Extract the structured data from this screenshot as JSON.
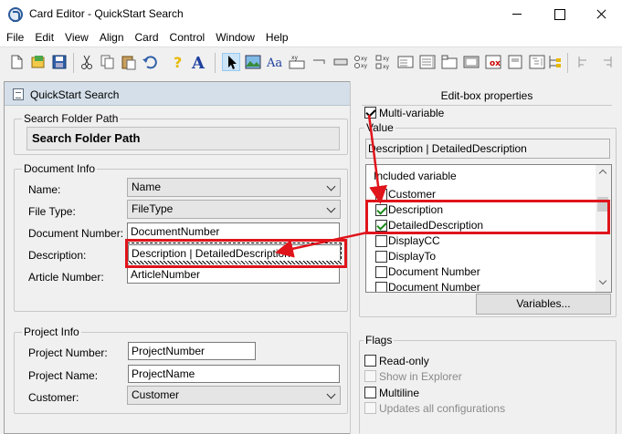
{
  "window": {
    "title": "Card Editor - QuickStart Search"
  },
  "menu": [
    "File",
    "Edit",
    "View",
    "Align",
    "Card",
    "Control",
    "Window",
    "Help"
  ],
  "toolbar": {
    "icons": [
      "new-document",
      "open",
      "save",
      "cut",
      "copy",
      "paste",
      "undo",
      "help",
      "font",
      "select-pointer",
      "picture",
      "label",
      "field",
      "line",
      "rectangle",
      "groupbox",
      "radio-set",
      "checkbox",
      "combo",
      "listbox",
      "tab",
      "image",
      "property",
      "tree",
      "align-left",
      "align-right"
    ],
    "text_glyphs": {
      "aa": "Aa",
      "xy": "XY",
      "ox": "ox"
    }
  },
  "card": {
    "title": "QuickStart Search",
    "search_group": {
      "label": "Search Folder Path",
      "value": "Search Folder Path"
    },
    "document_group": {
      "label": "Document Info",
      "fields": {
        "name": {
          "label": "Name:",
          "value": "Name"
        },
        "file_type": {
          "label": "File Type:",
          "value": "FileType"
        },
        "document_number": {
          "label": "Document Number:",
          "value": "DocumentNumber"
        },
        "description": {
          "label": "Description:",
          "value": "Description | DetailedDescription"
        },
        "article_number": {
          "label": "Article Number:",
          "value": "ArticleNumber"
        }
      }
    },
    "project_group": {
      "label": "Project Info",
      "fields": {
        "project_number": {
          "label": "Project Number:",
          "value": "ProjectNumber"
        },
        "project_name": {
          "label": "Project Name:",
          "value": "ProjectName"
        },
        "customer": {
          "label": "Customer:",
          "value": "Customer"
        }
      }
    }
  },
  "properties": {
    "title": "Edit-box properties",
    "multi_variable": {
      "label": "Multi-variable",
      "checked": true
    },
    "value": {
      "label": "Value",
      "text": "Description | DetailedDescription"
    },
    "list": {
      "header": "Included variable",
      "items": [
        {
          "label": "Customer",
          "checked": false
        },
        {
          "label": "Description",
          "checked": true
        },
        {
          "label": "DetailedDescription",
          "checked": true
        },
        {
          "label": "DisplayCC",
          "checked": false
        },
        {
          "label": "DisplayTo",
          "checked": false
        },
        {
          "label": "Document Number",
          "checked": false
        },
        {
          "label": "Document Number",
          "checked": false
        }
      ]
    },
    "variables_button": "Variables...",
    "flags": {
      "label": "Flags",
      "items": [
        {
          "label": "Read-only",
          "checked": false,
          "enabled": true
        },
        {
          "label": "Show in Explorer",
          "checked": false,
          "enabled": false
        },
        {
          "label": "Multiline",
          "checked": false,
          "enabled": true
        },
        {
          "label": "Updates all configurations",
          "checked": false,
          "enabled": false
        }
      ]
    }
  },
  "colors": {
    "highlight": "#e0141b",
    "check_green": "#1a8a1a",
    "card_header": "#d4dfe9"
  }
}
